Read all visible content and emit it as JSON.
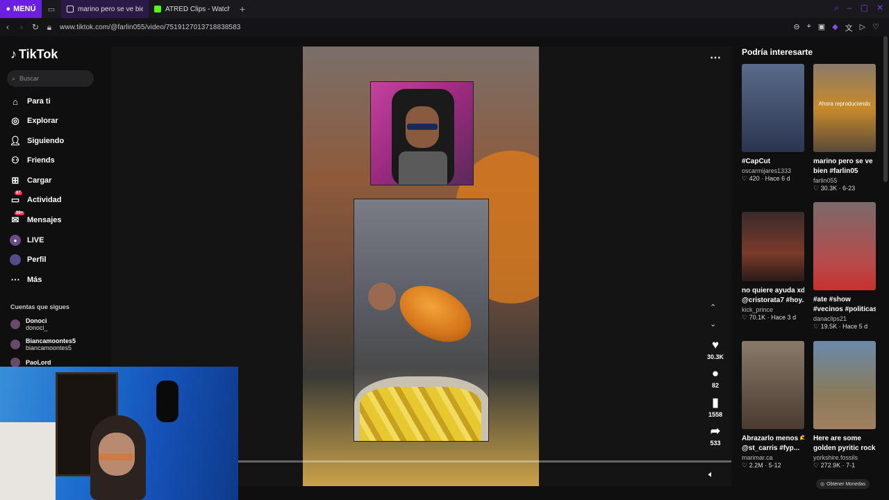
{
  "browser": {
    "menu_label": "MENÚ",
    "tabs": [
      {
        "title": "marino pero se ve bien #f",
        "color": "#7a3cf0"
      },
      {
        "title": "ATRED Clips - Watch Live",
        "color": "#53fc18"
      }
    ],
    "url": "www.tiktok.com/@farlin055/video/7519127013718838583"
  },
  "sidebar": {
    "logo": "TikTok",
    "search_placeholder": "Buscar",
    "items": [
      {
        "label": "Para ti",
        "icon": "home-icon"
      },
      {
        "label": "Explorar",
        "icon": "compass-icon"
      },
      {
        "label": "Siguiendo",
        "icon": "following-icon"
      },
      {
        "label": "Friends",
        "icon": "friends-icon"
      },
      {
        "label": "Cargar",
        "icon": "upload-icon"
      },
      {
        "label": "Actividad",
        "icon": "activity-icon",
        "badge": "87"
      },
      {
        "label": "Mensajes",
        "icon": "messages-icon",
        "badge": "99+"
      },
      {
        "label": "LIVE",
        "icon": "live-icon"
      },
      {
        "label": "Perfil",
        "icon": "profile-icon"
      },
      {
        "label": "Más",
        "icon": "more-icon"
      }
    ],
    "following_title": "Cuentas que sigues",
    "following": [
      {
        "name": "Donoci",
        "handle": "donoci_"
      },
      {
        "name": "Biancamoontes5",
        "handle": "biancamoontes5"
      },
      {
        "name": "PaoLord",
        "handle": ""
      }
    ]
  },
  "player": {
    "likes": "30.3K",
    "comments": "82",
    "saves": "1558",
    "shares": "533",
    "progress": 0.0
  },
  "recommendations": {
    "title": "Podría interesarte",
    "cards": [
      {
        "overlay": "",
        "caption1": "#CapCut",
        "caption2": "",
        "user": "oscarmijares1333",
        "stats": "♡ 420 · Hace 6 d",
        "bg": "linear-gradient(180deg,#5a6a8a,#2a3550)"
      },
      {
        "overlay": "Ahora reproduciendo",
        "caption1": "marino pero se ve",
        "caption2": "bien #farlin05",
        "user": "farlin055",
        "stats": "♡ 30.3K · 6-23",
        "bg": "linear-gradient(180deg,#8a7a6a,#c88a2a 50%,#5a4a3a)"
      },
      {
        "overlay": "",
        "caption1": "no quiere ayuda xd",
        "caption2": "@cristorata7 #hoy...",
        "user": "kick_prince",
        "stats": "♡ 70.1K · Hace 3 d",
        "bg": "linear-gradient(180deg,#3a2a2a,#7a3a2a 60%,#2a1a1a)"
      },
      {
        "overlay": "",
        "caption1": "#ate #show",
        "caption2": "#vecinos #politicas...",
        "user": "danaclips21",
        "stats": "♡ 19.5K · Hace 5 d",
        "bg": "linear-gradient(180deg,#7a6a6a,#b84a4a 70%,#c83030)"
      },
      {
        "overlay": "",
        "caption1": "Abrazarlo menos 🫶",
        "caption2": "@st_carris #fyp...",
        "user": "marimar.ca",
        "stats": "♡ 2.2M · 5-12",
        "bg": "linear-gradient(180deg,#8a7a6a,#4a3a30)"
      },
      {
        "overlay": "",
        "caption1": "Here are some",
        "caption2": "golden pyritic rock...",
        "user": "yorkshire.fossils",
        "stats": "♡ 272.9K · 7-1",
        "bg": "linear-gradient(180deg,#6a8aaa,#8a7a5a 60%,#a08060)"
      }
    ],
    "coin_pill": "Obtener Monedas"
  }
}
